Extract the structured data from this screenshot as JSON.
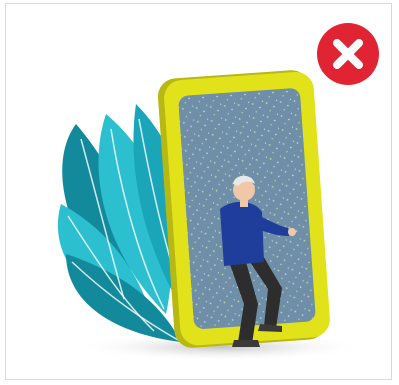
{
  "dialog": {
    "close_button": {
      "icon": "close-x-icon",
      "color": "#e02434",
      "glyph_color": "#ffffff"
    },
    "illustration": {
      "subject": "person-stepping-through-phone-illustration",
      "colors": {
        "phone_frame": "#e2e21a",
        "phone_frame_dark": "#b8b814",
        "screen": "#6f8fa8",
        "leaves_light": "#2bbfd0",
        "leaves_dark": "#138a9c",
        "shirt": "#1f3d9a",
        "pants": "#2d2d2d",
        "hair": "#e8e8e8",
        "shadow": "#d4d4d4"
      }
    }
  }
}
